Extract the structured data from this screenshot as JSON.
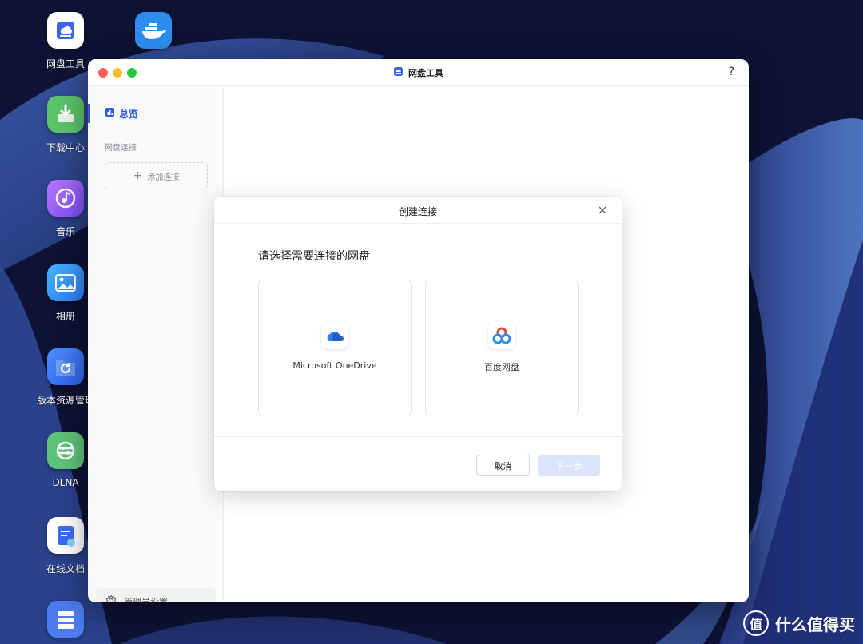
{
  "desktop": {
    "icons": [
      {
        "label": "网盘工具",
        "icon": "cloud-drive-icon"
      },
      {
        "label": "",
        "icon": "docker-icon"
      },
      {
        "label": "下载中心",
        "icon": "download-icon"
      },
      {
        "label": "音乐",
        "icon": "music-icon"
      },
      {
        "label": "相册",
        "icon": "photo-album-icon"
      },
      {
        "label": "版本资源管理",
        "icon": "version-manager-icon"
      },
      {
        "label": "DLNA",
        "icon": "dlna-icon"
      },
      {
        "label": "在线文档",
        "icon": "online-doc-icon"
      },
      {
        "label": "",
        "icon": "server-icon"
      }
    ]
  },
  "window": {
    "title": "网盘工具",
    "help": "?"
  },
  "sidebar": {
    "overview": "总览",
    "section_label": "网盘连接",
    "add_connection": "添加连接",
    "admin_settings": "管理员设置"
  },
  "modal": {
    "title": "创建连接",
    "question": "请选择需要连接的网盘",
    "options": [
      {
        "label": "Microsoft OneDrive",
        "icon": "onedrive-icon"
      },
      {
        "label": "百度网盘",
        "icon": "baidu-netdisk-icon"
      }
    ],
    "cancel": "取消",
    "next": "下一步"
  },
  "watermark": {
    "text": "什么值得买",
    "logo": "值"
  },
  "colors": {
    "accent": "#2f5bea",
    "next_disabled": "#dbe6fd",
    "desktop_bg": "#0f1336"
  }
}
